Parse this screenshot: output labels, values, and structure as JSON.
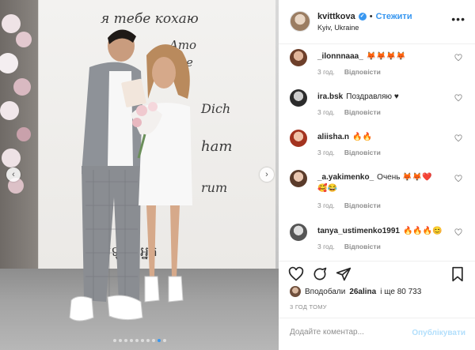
{
  "photo": {
    "backdrop_lines": [
      "я тебе кохаю",
      "Amo",
      "te",
      "Dich",
      "ham",
      "rum",
      "ស្រឡាញ់អ្នក"
    ],
    "slide_count": 10,
    "active_slide": 8
  },
  "header": {
    "username": "kvittkova",
    "follow_label": "Стежити",
    "location": "Kyiv, Ukraine"
  },
  "comments": [
    {
      "user": "_ilonnnaaa_",
      "text": "🦊🦊🦊🦊",
      "time": "3 год.",
      "reply": "Відповісти"
    },
    {
      "user": "ira.bsk",
      "text": "Поздравляю ♥",
      "time": "3 год.",
      "reply": "Відповісти"
    },
    {
      "user": "aliisha.n",
      "text": "🔥🔥",
      "time": "3 год.",
      "reply": "Відповісти"
    },
    {
      "user": "_a.yakimenko_",
      "text": "Очень 🦊🦊❤️",
      "text2": "🥰😂",
      "time": "3 год.",
      "reply": "Відповісти"
    },
    {
      "user": "tanya_ustimenko1991",
      "text": "🔥🔥🔥😊",
      "time": "3 год.",
      "reply": "Відповісти"
    }
  ],
  "likes": {
    "prefix": "Вподобали",
    "user": "26alina",
    "suffix": "і ще 80 733"
  },
  "time_ago": "3 ГОД ТОМУ",
  "comment_input": {
    "placeholder": "Додайте коментар...",
    "post_label": "Опублікувати"
  },
  "icons": [
    "heart-icon",
    "comment-icon",
    "share-icon",
    "bookmark-icon",
    "more-icon",
    "verified-icon",
    "chevron-left-icon",
    "chevron-right-icon"
  ],
  "colors": {
    "accent": "#3897f0",
    "text": "#262626",
    "muted": "#8e8e8e",
    "post_disabled": "#b2dffc"
  }
}
